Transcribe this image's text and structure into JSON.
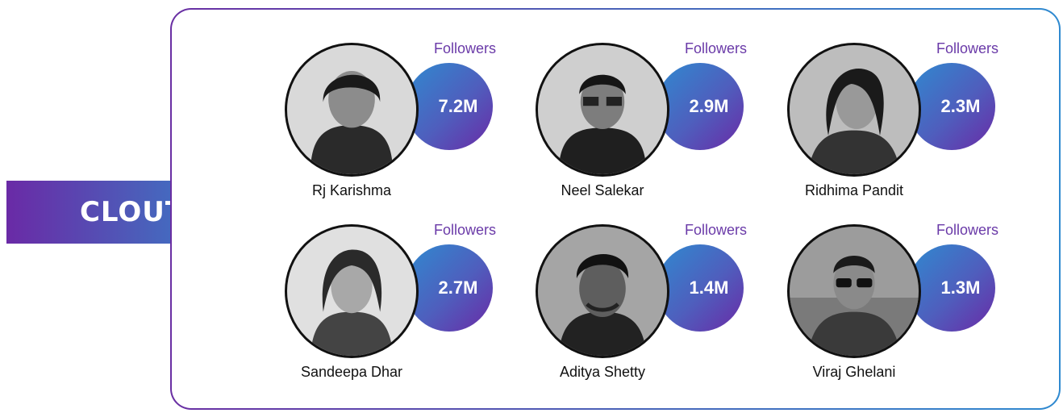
{
  "brand": {
    "logo_text": "CLOUT"
  },
  "influencers": [
    {
      "name": "Rj Karishma",
      "followers_label": "Followers",
      "followers": "7.2M"
    },
    {
      "name": "Neel Salekar",
      "followers_label": "Followers",
      "followers": "2.9M"
    },
    {
      "name": "Ridhima Pandit",
      "followers_label": "Followers",
      "followers": "2.3M"
    },
    {
      "name": "Sandeepa Dhar",
      "followers_label": "Followers",
      "followers": "2.7M"
    },
    {
      "name": "Aditya Shetty",
      "followers_label": "Followers",
      "followers": "1.4M"
    },
    {
      "name": "Viraj Ghelani",
      "followers_label": "Followers",
      "followers": "1.3M"
    }
  ],
  "colors": {
    "accent_purple": "#6a2aa6",
    "accent_blue": "#2f89d2"
  }
}
